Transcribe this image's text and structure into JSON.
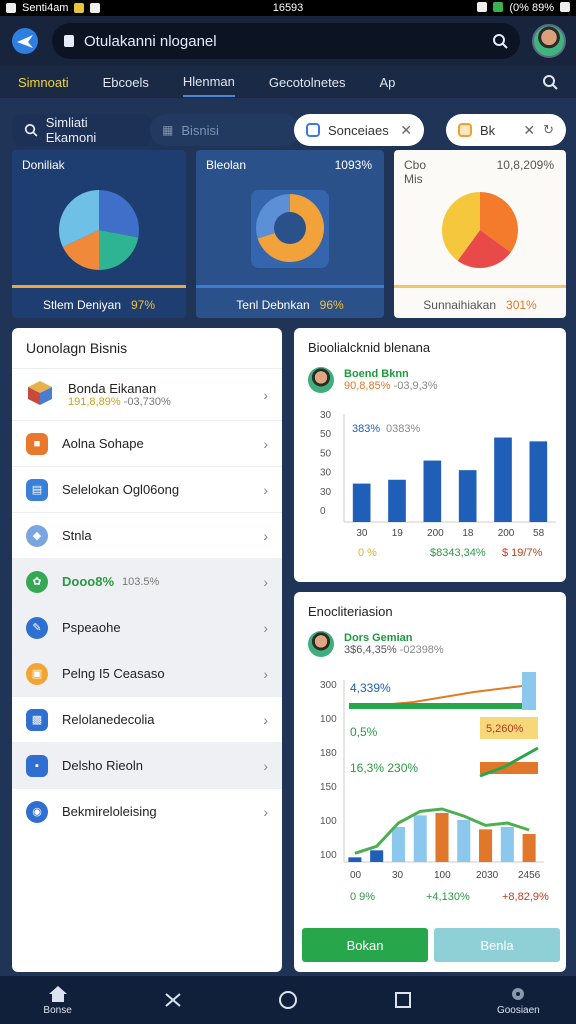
{
  "status_bar": {
    "left_text": "Senti4am",
    "time": "16593",
    "right_text": "(0% 89%"
  },
  "app_bar": {
    "title": "Otulakanni nloganel",
    "search_icon": "search-icon"
  },
  "nav": {
    "tabs": [
      {
        "label": "Simnoati",
        "active": true
      },
      {
        "label": "Ebcoels"
      },
      {
        "label": "Hlenman",
        "selected": true
      },
      {
        "label": "Gecotolnetes"
      },
      {
        "label": "Ap"
      }
    ]
  },
  "filters": {
    "search_label": "Simliati Ekamoni",
    "faded_label": "Bisnisi",
    "chip1": "Sonceiaes",
    "chip2": "Bk"
  },
  "top_cards": [
    {
      "title": "Doniliak",
      "foot_label": "Stlem Deniyan",
      "foot_value": "97%"
    },
    {
      "title": "Bleolan",
      "pct": "1093%",
      "foot_label": "Tenl Debnkan",
      "foot_value": "96%"
    },
    {
      "title": "Cbo",
      "subtitle": "Mis",
      "pct": "10,8,209%",
      "foot_label": "Sunnaihiakan",
      "foot_value": "301%"
    }
  ],
  "pie1": [
    28,
    22,
    18,
    32
  ],
  "pie2": [
    70,
    30
  ],
  "pie3": [
    35,
    25,
    40
  ],
  "list": {
    "header": "Uonolagn Bisnis",
    "items": [
      {
        "label": "Bonda Eikanan",
        "sub_a": "191,8,89%",
        "sub_b": "-03,730%",
        "icon": "cube-icon",
        "color": "#c85b4a"
      },
      {
        "label": "Aolna Sohape",
        "icon": "briefcase-icon",
        "color": "#e8782c"
      },
      {
        "label": "Selelokan Ogl06ong",
        "icon": "doc-icon",
        "color": "#3a7fd8"
      },
      {
        "label": "Stnla",
        "icon": "tag-icon",
        "color": "#7aa6e0"
      },
      {
        "label": "Dooo8%",
        "sub_inline": "103.5%",
        "icon": "leaf-icon",
        "color": "#34a853",
        "shade": true,
        "green": true
      },
      {
        "label": "Pspeaohe",
        "icon": "pen-icon",
        "color": "#2f6fd2",
        "shade": true
      },
      {
        "label": "Pelng I5 Ceasaso",
        "icon": "calendar-icon",
        "color": "#f3a533",
        "shade": true
      },
      {
        "label": "Relolanedecolia",
        "icon": "chart-icon",
        "color": "#2f6fd2"
      },
      {
        "label": "Delsho Rieoln",
        "icon": "box-icon",
        "color": "#2f6fd2",
        "shade": true
      },
      {
        "label": "Bekmireloleising",
        "icon": "globe-icon",
        "color": "#2f6fd2"
      }
    ]
  },
  "panel_a": {
    "title": "Bioolialcknid blenana",
    "person": "Boend Bknn",
    "n1": "90,8,85%",
    "n2": "-03,9,3%",
    "legend": "383%",
    "legend2": "0383%",
    "yticks": [
      "30",
      "50",
      "50",
      "30",
      "30",
      "0"
    ],
    "xticks": [
      "30",
      "19",
      "200",
      "18",
      "200",
      "58"
    ],
    "foot": [
      "0 %",
      "$8343,34%",
      "$ 19/7%"
    ]
  },
  "chart_data": [
    {
      "type": "bar",
      "categories": [
        "30",
        "19",
        "200",
        "18",
        "200",
        "58"
      ],
      "series": [
        {
          "values": [
            20,
            22,
            32,
            27,
            44,
            42
          ]
        }
      ],
      "ylim": [
        0,
        50
      ]
    },
    {
      "type": "bar",
      "series": [
        {
          "values": [
            4,
            10,
            30,
            40,
            42,
            36,
            28,
            30,
            24
          ]
        }
      ],
      "ylim": [
        0,
        60
      ]
    }
  ],
  "panel_b": {
    "title": "Enocliteriasion",
    "person": "Dors Gemian",
    "n1": "3$6,4,35%",
    "n2": "-02398%",
    "l1": "4,339%",
    "l2": "0,5%",
    "l3": "16,3% 230%",
    "badge": "5,260%",
    "yticks": [
      "300",
      "100",
      "180",
      "150",
      "100",
      "100"
    ],
    "xticks": [
      "00",
      "30",
      "100",
      "2030",
      "2456"
    ],
    "foot": [
      "0 9%",
      "+4,130%",
      "+8,82,9%"
    ],
    "btn1": "Bokan",
    "btn2": "Benla"
  },
  "bottom_nav": {
    "home": "Bonse",
    "last": "Goosiaen"
  },
  "colors": {
    "bg": "#1f3456",
    "accent_yellow": "#f3d33b",
    "green": "#27a64b",
    "blue_bar": "#1f5fb8"
  }
}
